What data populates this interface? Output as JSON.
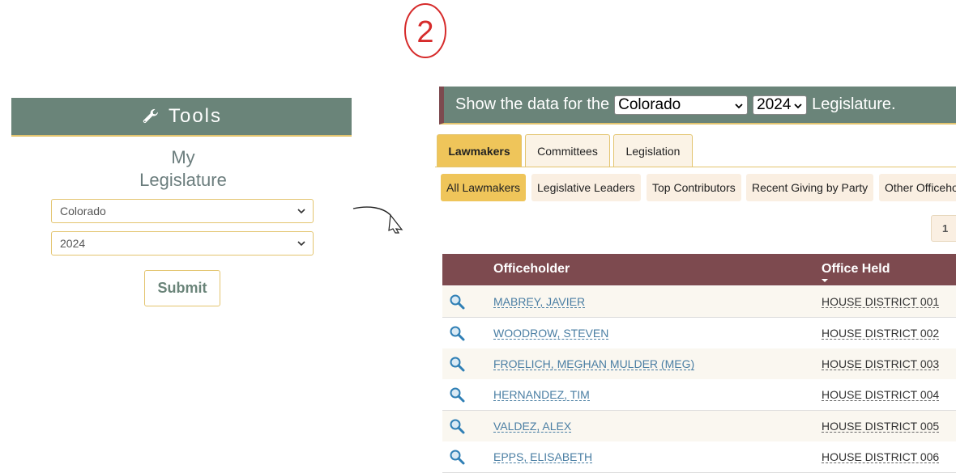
{
  "annotation": {
    "number": "2"
  },
  "tools": {
    "title": "Tools",
    "heading_line1": "My",
    "heading_line2": "Legislature",
    "state_value": "Colorado",
    "year_value": "2024",
    "submit_label": "Submit"
  },
  "banner": {
    "prefix": "Show the data for the",
    "state_value": "Colorado",
    "year_value": "2024",
    "suffix": "Legislature."
  },
  "tabs": [
    {
      "label": "Lawmakers",
      "active": true
    },
    {
      "label": "Committees",
      "active": false
    },
    {
      "label": "Legislation",
      "active": false
    }
  ],
  "subtabs": [
    {
      "label": "All Lawmakers",
      "active": true
    },
    {
      "label": "Legislative Leaders",
      "active": false
    },
    {
      "label": "Top Contributors",
      "active": false
    },
    {
      "label": "Recent Giving by Party",
      "active": false
    },
    {
      "label": "Other Officeho",
      "active": false
    }
  ],
  "pager": {
    "page": "1"
  },
  "table": {
    "columns": [
      "Officeholder",
      "Office Held"
    ],
    "rows": [
      {
        "name": "MABREY, JAVIER",
        "office": "HOUSE DISTRICT 001"
      },
      {
        "name": "WOODROW, STEVEN",
        "office": "HOUSE DISTRICT 002"
      },
      {
        "name": "FROELICH, MEGHAN MULDER (MEG)",
        "office": "HOUSE DISTRICT 003"
      },
      {
        "name": "HERNANDEZ, TIM",
        "office": "HOUSE DISTRICT 004"
      },
      {
        "name": "VALDEZ, ALEX",
        "office": "HOUSE DISTRICT 005"
      },
      {
        "name": "EPPS, ELISABETH",
        "office": "HOUSE DISTRICT 006"
      }
    ]
  },
  "colors": {
    "header_green": "#6a8479",
    "gold": "#efc55a",
    "maroon": "#7d4a4f",
    "link_blue": "#4a7ea3"
  }
}
